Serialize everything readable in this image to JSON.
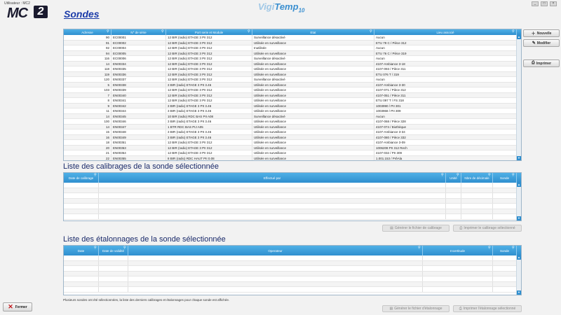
{
  "app": {
    "user_label": "Utilisateur : MC2",
    "logo_mc": "MC",
    "logo_two": "2",
    "brand_pre": "Vigi",
    "brand_main": "Temp",
    "brand_sub": "10",
    "page_title": "Sondes"
  },
  "window_controls": [
    "_",
    "□",
    "×"
  ],
  "sondes": {
    "columns": [
      "Adresse",
      "N° de série",
      "Port serie et Module",
      "Etat",
      "Lieu associé"
    ],
    "rows": [
      [
        "90",
        "EC00001",
        "12  BIR (radio)  ETAGE 3 PII 312",
        "Surveillance désactivé",
        "Aucun"
      ],
      [
        "91",
        "EC00002",
        "12  BIR (radio)  ETAGE 3 PII 312",
        "Utilisée en surveillance",
        "ETU 79 C / Pièce 312"
      ],
      [
        "92",
        "EC00004",
        "12  BIR (radio)  ETAGE 3 PII 312",
        "Inutilisée",
        "Aucun"
      ],
      [
        "94",
        "EC00005",
        "12  BIR (radio)  ETAGE 3 PII 312",
        "Utilisée en surveillance",
        "ETU 76 C / Pièce 319"
      ],
      [
        "116",
        "EC00006",
        "12  BIR (radio)  ETAGE 3 PII 312",
        "Surveillance désactivé",
        "Aucun"
      ],
      [
        "14",
        "EN00334",
        "12  BIR (radio)  ETAGE 3 PII 312",
        "Utilisée en surveillance",
        "4107-Ambiance 3-18"
      ],
      [
        "118",
        "EN00335",
        "12  BIR (radio)  ETAGE 3 PII 312",
        "Utilisée en surveillance",
        "4107-093 / Pièce 311"
      ],
      [
        "119",
        "EN00336",
        "12  BIR (radio)  ETAGE 3 PII 312",
        "Utilisée en surveillance",
        "ETU 076 T / 319"
      ],
      [
        "120",
        "EN00337",
        "12  BIR (radio)  ETAGE 3 PII 312",
        "Surveillance désactivé",
        "Aucun"
      ],
      [
        "5",
        "EN00338",
        "3  BIR (radio)  ETAGE 3 PII 3.46",
        "Utilisée en surveillance",
        "4107-Ambiance 3-30"
      ],
      [
        "103",
        "EN00339",
        "12  BIR (radio)  ETAGE 3 PII 312",
        "Utilisée en surveillance",
        "4107-071 / Pièce 312"
      ],
      [
        "7",
        "EN00340",
        "12  BIR (radio)  ETAGE 3 PII 312",
        "Utilisée en surveillance",
        "4107-051 / Pièce 311"
      ],
      [
        "8",
        "EN00341",
        "12  BIR (radio)  ETAGE 3 PII 312",
        "Utilisée en surveillance",
        "ETU 097 T / FS 318"
      ],
      [
        "9",
        "EN00342",
        "3  BIR (radio)  ETAGE 3 PII 3.46",
        "Utilisée en surveillance",
        "1003990 / PII 301"
      ],
      [
        "11",
        "EN00344",
        "3  BIR (radio)  ETAGE 3 PII 3.46",
        "Utilisée en surveillance",
        "1003968 / PII 309"
      ],
      [
        "14",
        "EN00345",
        "10  BIR (radio)  RDC BAS PII A08",
        "Surveillance désactivé",
        "Aucun"
      ],
      [
        "100",
        "EN00346",
        "3  BIR (radio)  ETAGE 3 PII 3.46",
        "Utilisée en surveillance",
        "4107-068 / Pièce 328"
      ],
      [
        "14",
        "EN00347",
        "1  BTR  RDC BAS PIJ A05",
        "Utilisée en surveillance",
        "4107-074 / Biothèque"
      ],
      [
        "15",
        "EN00348",
        "3  BIR (radio)  ETAGE 3 PII 3.46",
        "Utilisée en surveillance",
        "4107-Ambiance 3-34"
      ],
      [
        "16",
        "EN00349",
        "3  BIR (radio)  ETAGE 3 PII 3.46",
        "Utilisée en surveillance",
        "4107-080 / Pièce 332"
      ],
      [
        "18",
        "EN00351",
        "12  BIR (radio)  ETAGE 3 PII 312",
        "Utilisée en surveillance",
        "4107-Ambiance 3-09"
      ],
      [
        "20",
        "EN00353",
        "12  BIR (radio)  ETAGE 3 PII 312",
        "Utilisée en surveillance",
        "1006208 PII 312 Rech"
      ],
      [
        "21",
        "EN00354",
        "12  BIR (radio)  ETAGE 3 PII 312",
        "Utilisée en surveillance",
        "4107-032 / PII 309"
      ],
      [
        "22",
        "EN00355",
        "8  BIR (radio)  RDC HAUT PII 0.08",
        "Utilisée en surveillance",
        "1.001.153 / PrêAla"
      ]
    ]
  },
  "calibrages": {
    "title": "Liste des calibrages de la sonde sélectionnée",
    "columns": [
      "Date de calibrage",
      "Effectué par",
      "Unité",
      "Nbre de décimale",
      "Sonde"
    ],
    "btn_generate": "Générer le fichier de calibrage",
    "btn_print": "Imprimer le calibrage sélectionné"
  },
  "etalonnages": {
    "title": "Liste des étalonnages de la sonde sélectionnée",
    "columns": [
      "Date",
      "Date de validité",
      "Operateur",
      "Incertitude",
      "Sonde"
    ],
    "btn_generate": "Générer le fichier d'étalonnage",
    "btn_print": "Imprimer l'étalonnage sélectionné"
  },
  "side": {
    "new_label": "Nouvelle",
    "edit_label": "Modifier",
    "print_label": "Imprimer"
  },
  "note": "Plusieurs sondes ont été sélectionnées, la liste des derniers calibrages et étalonnages pour chaque sonde est affichée.",
  "close_label": "Fermer",
  "colors": {
    "header": "#2f8fcf",
    "title": "#1a3aa8",
    "section": "#1a2a6a"
  }
}
